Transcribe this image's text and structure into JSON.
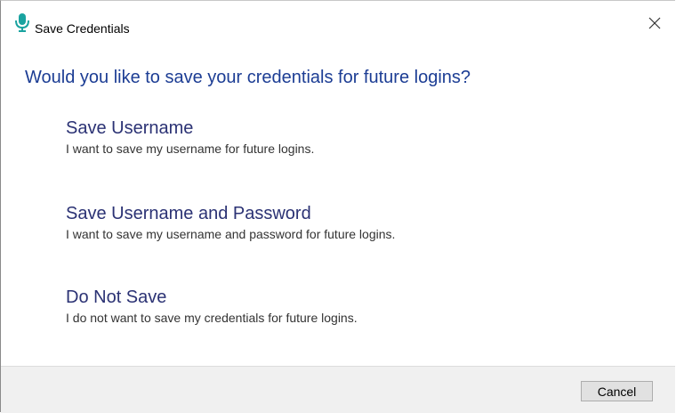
{
  "window": {
    "title": "Save Credentials",
    "title_icon": "microphone-icon",
    "close_icon": "close-icon"
  },
  "dialog": {
    "heading": "Would you like to save your credentials for future logins?",
    "options": [
      {
        "title": "Save Username",
        "description": "I want to save my username for future logins."
      },
      {
        "title": "Save Username and Password",
        "description": "I want to save my username and password for future logins."
      },
      {
        "title": "Do Not Save",
        "description": "I do not want to save my credentials for future logins."
      }
    ]
  },
  "footer": {
    "cancel_label": "Cancel"
  },
  "colors": {
    "heading": "#1c3d94",
    "option_title": "#2b3274",
    "icon": "#1aa3a0"
  }
}
